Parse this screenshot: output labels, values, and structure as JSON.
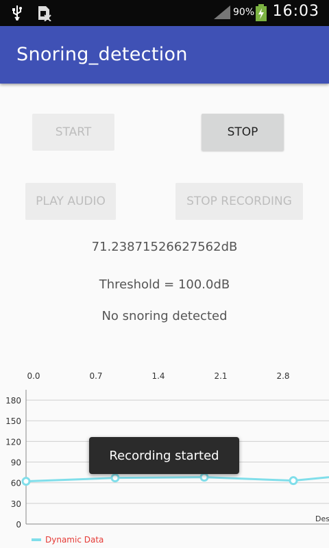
{
  "statusbar": {
    "usb_icon": "usb-icon",
    "sim_icon": "sim-icon",
    "signal_icon": "signal-icon",
    "battery_percent": "90%",
    "battery_icon": "battery-charging-icon",
    "time": "16:03"
  },
  "appbar": {
    "title": "Snoring_detection",
    "color": "#3f51b5"
  },
  "buttons": {
    "start": "START",
    "stop": "STOP",
    "play_audio": "PLAY AUDIO",
    "stop_recording": "STOP RECORDING"
  },
  "readout": {
    "level": "71.23871526627562dB",
    "threshold": "Threshold = 100.0dB",
    "status": "No snoring detected"
  },
  "toast": {
    "text": "Recording started"
  },
  "chart_data": {
    "type": "line",
    "x_top_ticks": [
      "0.0",
      "0.7",
      "1.4",
      "2.1",
      "2.8"
    ],
    "y_ticks": [
      "180",
      "150",
      "120",
      "90",
      "60",
      "30",
      "0"
    ],
    "ylim": [
      0,
      195
    ],
    "xlabel_partial": "Des",
    "series": [
      {
        "name": "Dynamic Data",
        "color": "#80deea",
        "x": [
          0.0,
          1.0,
          2.0,
          3.0,
          3.4
        ],
        "y": [
          62,
          67,
          68,
          63,
          68
        ]
      }
    ],
    "grid": true,
    "legend": "bottom-left"
  }
}
